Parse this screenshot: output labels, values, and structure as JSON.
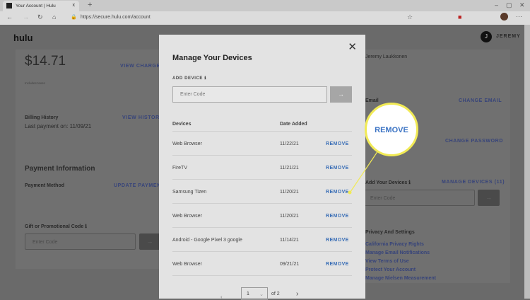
{
  "browser": {
    "tab_title": "Your Account | Hulu",
    "url": "https://secure.hulu.com/account",
    "tab_close": "x",
    "new_tab": "+"
  },
  "header": {
    "logo": "hulu",
    "avatar_initial": "J",
    "user": "JEREMY"
  },
  "billing": {
    "amount": "$14.71",
    "view_charges": "VIEW CHARGES",
    "includes_taxes": "Includes taxes",
    "history_label": "Billing History",
    "view_history": "VIEW HISTORY",
    "last_payment": "Last payment on: 11/09/21"
  },
  "payment": {
    "title": "Payment Information",
    "method_label": "Payment Method",
    "update": "UPDATE PAYMENT",
    "gift_label": "Gift or Promotional Code",
    "gift_placeholder": "Enter Code"
  },
  "account": {
    "name": "Jeremy Laukkonen",
    "email_label": "Email",
    "change_email": "CHANGE EMAIL",
    "change_password": "CHANGE PASSWORD",
    "add_devices_label": "Add Your Devices",
    "manage_devices": "MANAGE DEVICES (11)",
    "code_placeholder": "Enter Code"
  },
  "privacy": {
    "title": "Privacy And Settings",
    "links": [
      "California Privacy Rights",
      "Manage Email Notifications",
      "View Terms of Use",
      "Protect Your Account",
      "Manage Nielsen Measurement"
    ]
  },
  "modal": {
    "title": "Manage Your Devices",
    "add_device": "ADD DEVICE",
    "code_placeholder": "Enter Code",
    "col_devices": "Devices",
    "col_date": "Date Added",
    "rows": [
      {
        "device": "Web Browser",
        "date": "11/22/21",
        "action": "REMOVE"
      },
      {
        "device": "FireTV",
        "date": "11/21/21",
        "action": "REMOVE"
      },
      {
        "device": "Samsung Tizen",
        "date": "11/20/21",
        "action": "REMOVE"
      },
      {
        "device": "Web Browser",
        "date": "11/20/21",
        "action": "REMOVE"
      },
      {
        "device": "Android - Google Pixel 3 google",
        "date": "11/14/21",
        "action": "REMOVE"
      },
      {
        "device": "Web Browser",
        "date": "09/21/21",
        "action": "REMOVE"
      }
    ],
    "page": "1",
    "of_pages": "of 2"
  },
  "callout": {
    "text": "REMOVE",
    "color": "#f1ea55"
  }
}
